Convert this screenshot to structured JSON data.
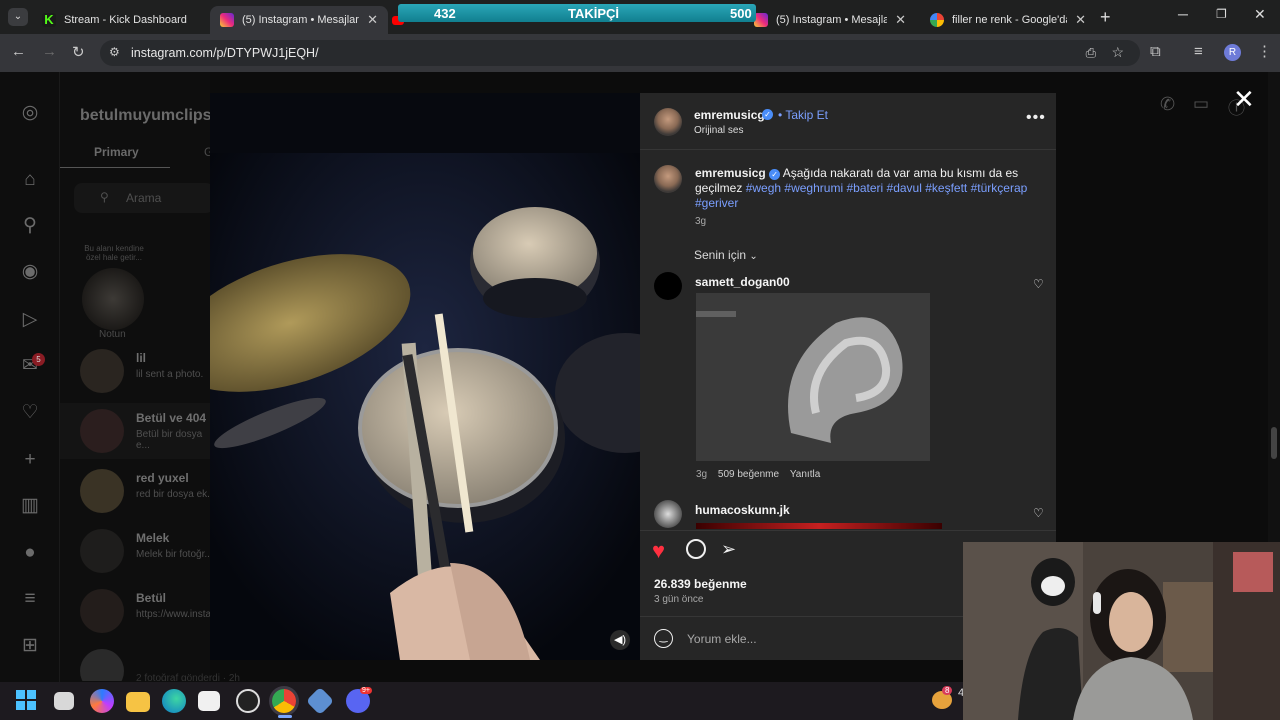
{
  "tabs": [
    {
      "title": "Stream - Kick Dashboard"
    },
    {
      "title": "(5) Instagram • Mesajlar"
    },
    {
      "title": "(5) Instagram • Mesajlar"
    },
    {
      "title": "filler ne renk - Google'da Ara"
    }
  ],
  "follower_overlay": {
    "current": "432",
    "label": "TAKİPÇİ",
    "goal": "500",
    "progress": 0.86
  },
  "address_bar": {
    "url": "instagram.com/p/DTYPWJ1jEQH/",
    "profile_initial": "R"
  },
  "dm_sidebar": {
    "username": "betulmuyumclips",
    "tab_primary": "Primary",
    "tab_general_partial": "G",
    "search_placeholder": "Arama",
    "note_bubble": "Bu alanı kendine özel hale getir...",
    "note_label": "Notun",
    "notification_badge": "5",
    "conversations": [
      {
        "name": "lil",
        "preview": "lil sent a photo."
      },
      {
        "name": "Betül ve 404",
        "preview": "Betül bir dosya e..."
      },
      {
        "name": "red yuxel",
        "preview": "red bir dosya ek..."
      },
      {
        "name": "Melek",
        "preview": "Melek bir fotoğr..."
      },
      {
        "name": "Betül",
        "preview": "https://www.insta..."
      },
      {
        "name": "",
        "preview": "2 fotoğraf gönderdi · 2h"
      }
    ]
  },
  "post": {
    "author": "emremusicg",
    "follow_label": "Takip Et",
    "audio": "Orijinal ses",
    "caption_text": "Aşağıda nakaratı da var ama bu kısmı da es geçilmez",
    "hashtags": [
      "#wegh",
      "#weghrumi",
      "#bateri",
      "#davul",
      "#keşfett",
      "#türkçerap",
      "#geriver"
    ],
    "caption_age": "3g",
    "sort_label": "Senin için",
    "comments": [
      {
        "user": "samett_dogan00",
        "age": "3g",
        "likes": "509 beğenme",
        "reply": "Yanıtla"
      },
      {
        "user": "humacoskunn.jk"
      }
    ],
    "likes": "26.839 beğenme",
    "date": "3 gün önce",
    "comment_placeholder": "Yorum ekle..."
  },
  "taskbar": {
    "badge_left": "8",
    "clock_partial": "4",
    "discord_badge": "9+"
  },
  "colors": {
    "accent_blue": "#4a8df8",
    "like_red": "#ff3040",
    "hashtag": "#7b9fff"
  }
}
